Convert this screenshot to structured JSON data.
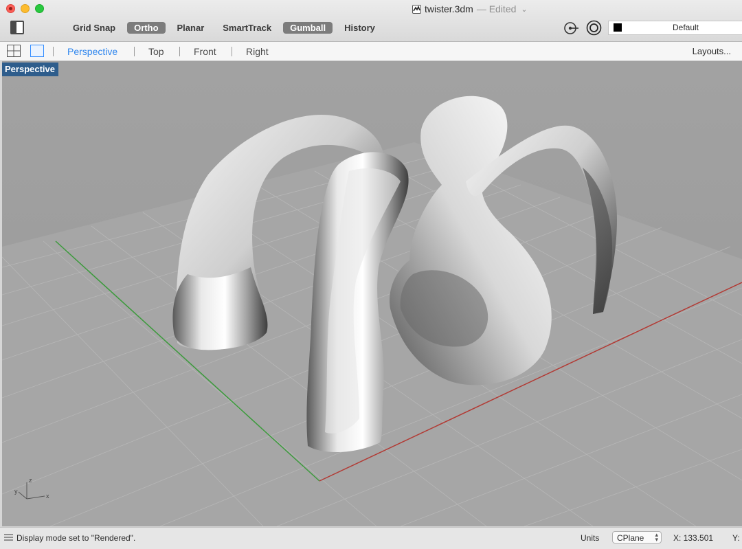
{
  "window": {
    "title": "twister.3dm",
    "status": "— Edited"
  },
  "toolbar": {
    "modes": [
      {
        "label": "Grid Snap",
        "active": false
      },
      {
        "label": "Ortho",
        "active": true
      },
      {
        "label": "Planar",
        "active": false
      },
      {
        "label": "SmartTrack",
        "active": false
      },
      {
        "label": "Gumball",
        "active": true
      },
      {
        "label": "History",
        "active": false
      }
    ],
    "layer": {
      "name": "Default",
      "color": "#000000"
    }
  },
  "viewport_tabs": {
    "tabs": [
      {
        "label": "Perspective",
        "active": true
      },
      {
        "label": "Top",
        "active": false
      },
      {
        "label": "Front",
        "active": false
      },
      {
        "label": "Right",
        "active": false
      }
    ],
    "layouts_label": "Layouts..."
  },
  "viewport": {
    "label": "Perspective",
    "display_mode": "Rendered",
    "axes": {
      "x_color": "#b23a34",
      "y_color": "#3c9a3c"
    },
    "axis_icon_labels": {
      "z": "z",
      "y": "y",
      "x": "x"
    }
  },
  "statusbar": {
    "message": "Display mode set to \"Rendered\".",
    "units_label": "Units",
    "cplane_label": "CPlane",
    "x_coord": "X: 133.501",
    "y_coord": "Y:"
  }
}
